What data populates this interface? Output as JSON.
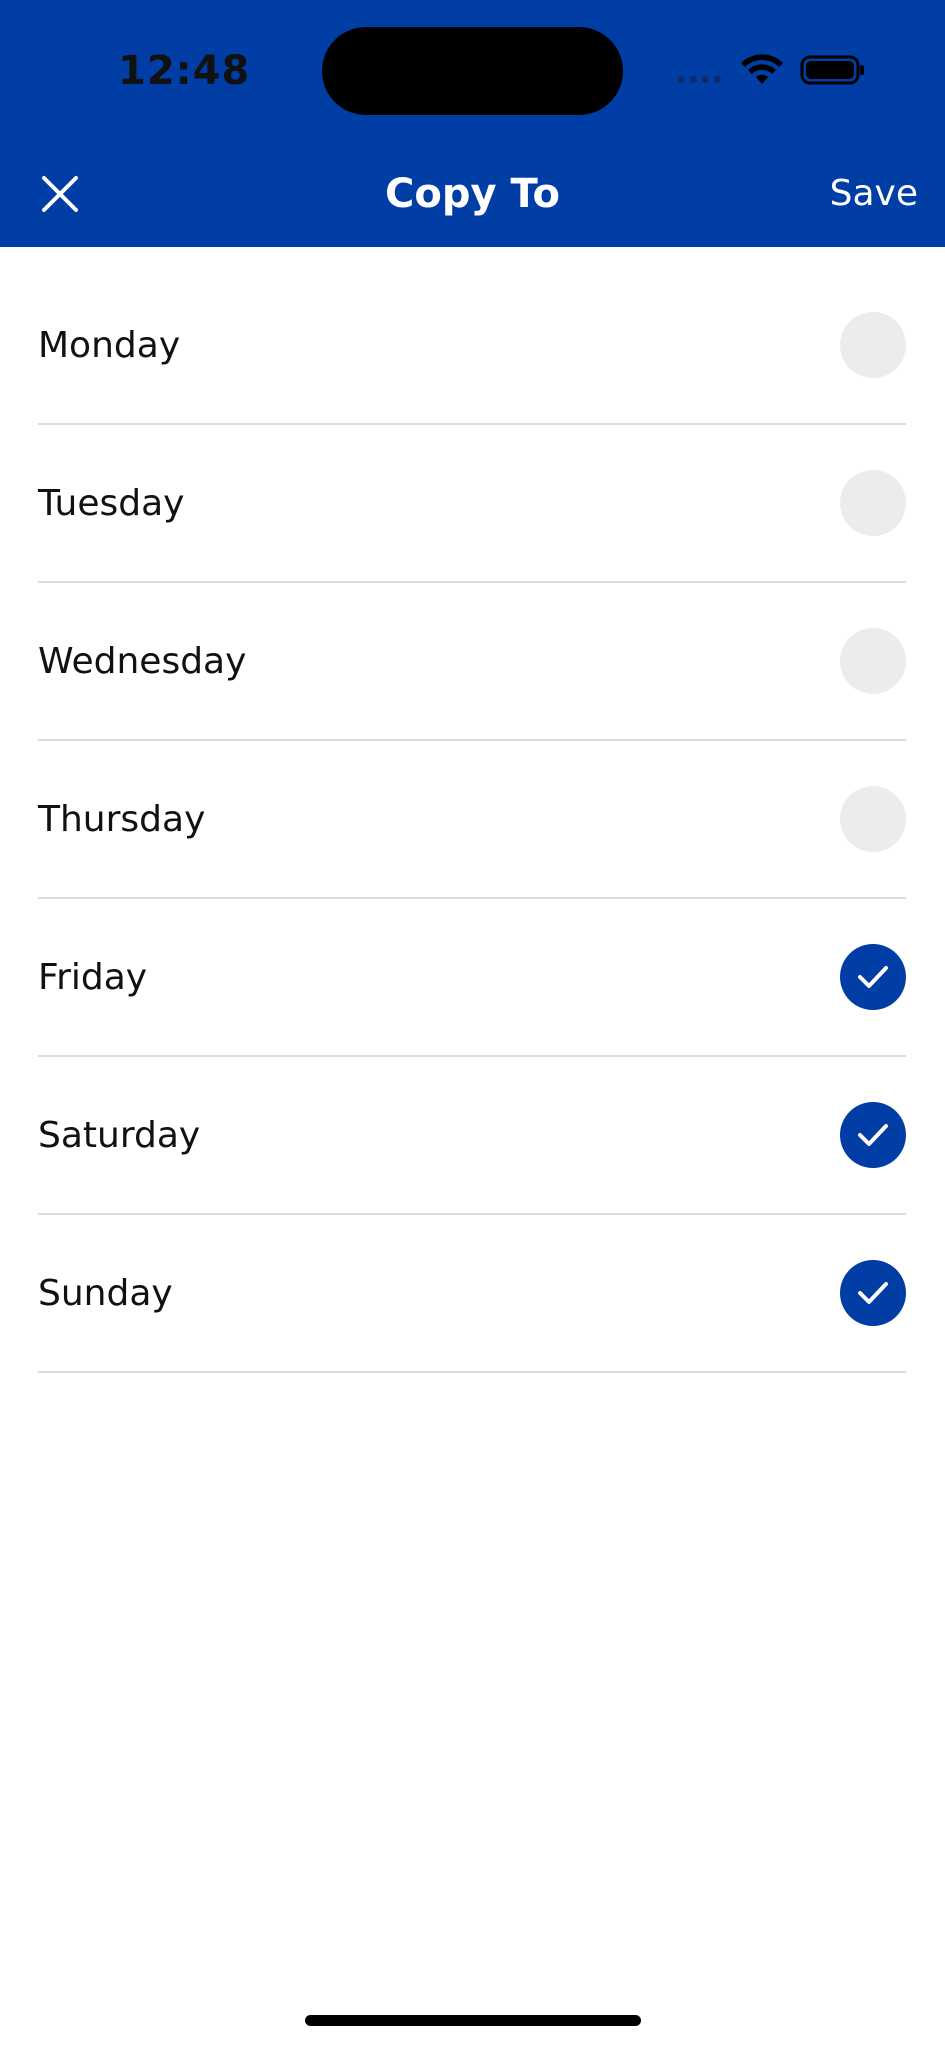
{
  "status_bar": {
    "time": "12:48",
    "wifi_icon": "wifi-icon",
    "battery_icon": "battery-icon"
  },
  "header": {
    "title": "Copy To",
    "save_label": "Save",
    "close_icon": "close-icon",
    "background": "#003DA5"
  },
  "days": [
    {
      "label": "Monday",
      "checked": false
    },
    {
      "label": "Tuesday",
      "checked": false
    },
    {
      "label": "Wednesday",
      "checked": false
    },
    {
      "label": "Thursday",
      "checked": false
    },
    {
      "label": "Friday",
      "checked": true
    },
    {
      "label": "Saturday",
      "checked": true
    },
    {
      "label": "Sunday",
      "checked": true
    }
  ],
  "colors": {
    "accent": "#003DA5",
    "unchecked": "#ECECEC",
    "divider": "#DCDCDC"
  }
}
